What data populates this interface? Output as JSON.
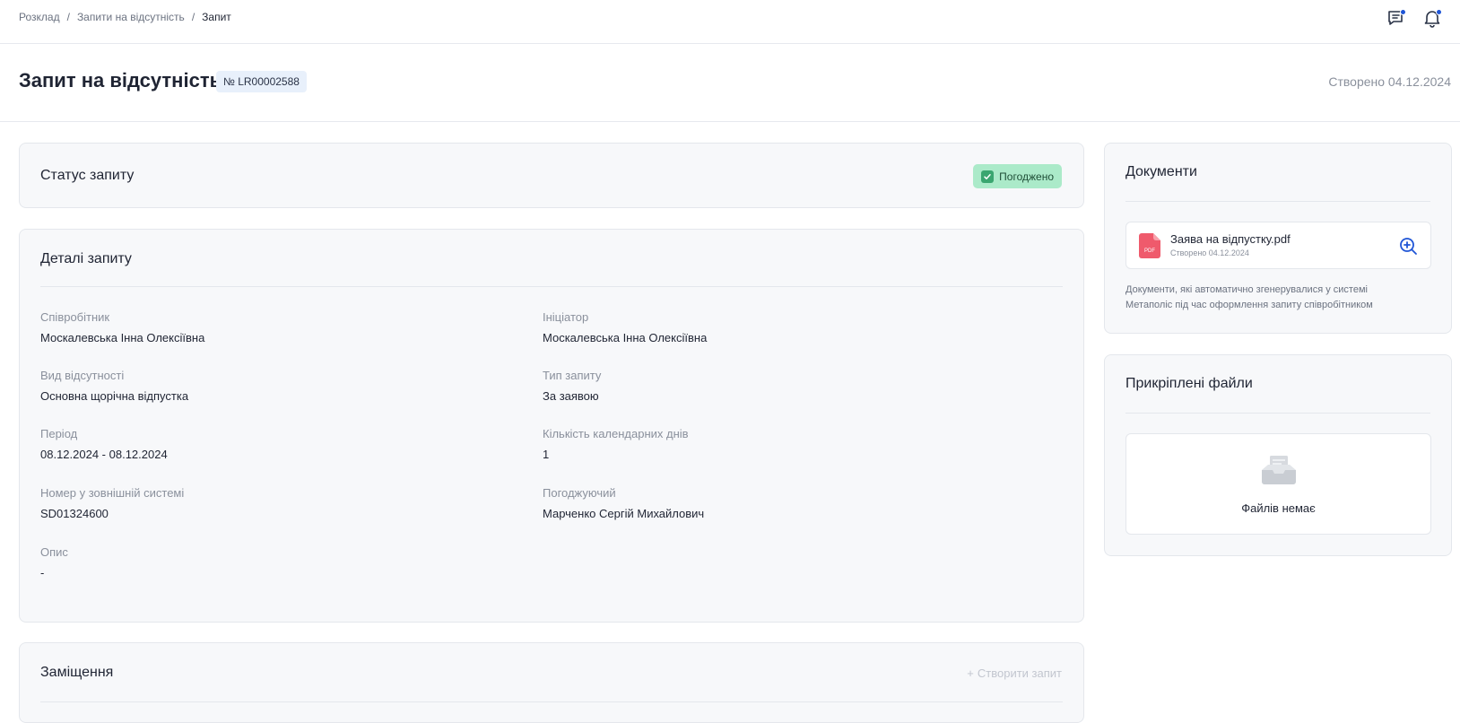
{
  "breadcrumb": {
    "items": [
      "Розклад",
      "Запити на відсутність"
    ],
    "current": "Запит",
    "separator": "/"
  },
  "topbar": {
    "icons": [
      "chat-icon",
      "bell-icon"
    ],
    "notification_color": "#1f55d6"
  },
  "header": {
    "title": "Запит на відсутність",
    "request_number": "№ LR00002588",
    "created": "Створено 04.12.2024"
  },
  "status": {
    "title": "Статус запиту",
    "badge": "Погоджено",
    "badge_color": "#abeac9"
  },
  "details": {
    "title": "Деталі запиту",
    "fields": {
      "employee": {
        "label": "Співробітник",
        "value": "Москалевська Інна Олексіївна"
      },
      "initiator": {
        "label": "Ініціатор",
        "value": "Москалевська Інна Олексіївна"
      },
      "absence_type": {
        "label": "Вид відсутності",
        "value": "Основна щорічна відпустка"
      },
      "request_type": {
        "label": "Тип запиту",
        "value": "За заявою"
      },
      "period": {
        "label": "Період",
        "value": "08.12.2024 - 08.12.2024"
      },
      "days": {
        "label": "Кількість календарних днів",
        "value": "1"
      },
      "external_number": {
        "label": "Номер у зовнішній системі",
        "value": "SD01324600"
      },
      "approver": {
        "label": "Погоджуючий",
        "value": "Марченко Сергій Михайлович"
      },
      "description": {
        "label": "Опис",
        "value": "-"
      }
    }
  },
  "substitution": {
    "title": "Заміщення",
    "create_label": "Створити запит"
  },
  "documents": {
    "title": "Документи",
    "items": [
      {
        "name": "Заява на відпустку.pdf",
        "created": "Створено 04.12.2024",
        "icon_label": "PDF"
      }
    ],
    "note": "Документи, які автоматично згенерувалися у системі Метаполіс під час оформлення запиту співробітником"
  },
  "attached": {
    "title": "Прикріплені файли",
    "empty_text": "Файлів немає"
  }
}
